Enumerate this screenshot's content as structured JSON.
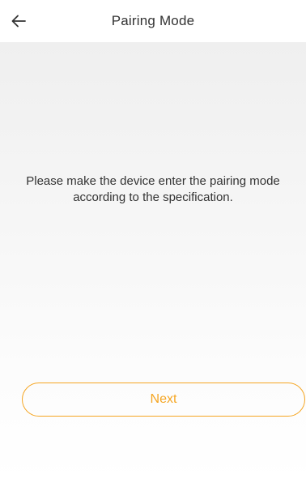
{
  "header": {
    "title": "Pairing Mode",
    "back_icon": "arrow-left-icon"
  },
  "main": {
    "instruction": "Please make the device enter the pairing mode according to the specification.",
    "next_label": "Next"
  },
  "colors": {
    "accent": "#f5a623",
    "text": "#333333",
    "background_top": "#efefef",
    "background_bottom": "#ffffff"
  }
}
